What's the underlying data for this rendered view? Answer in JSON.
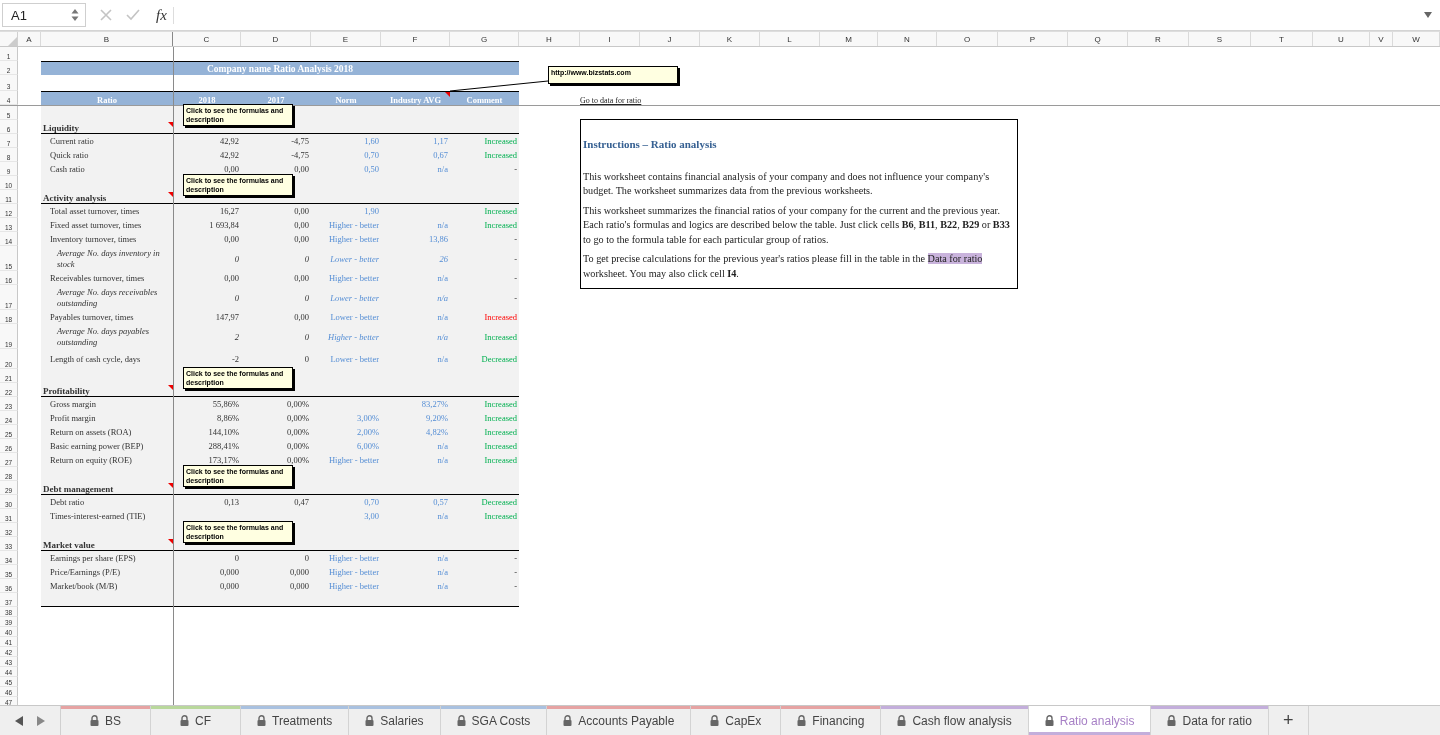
{
  "name_box": "A1",
  "function_label": "fx",
  "columns": [
    "A",
    "B",
    "C",
    "D",
    "E",
    "F",
    "G",
    "H",
    "I",
    "J",
    "K",
    "L",
    "M",
    "N",
    "O",
    "P",
    "Q",
    "R",
    "S",
    "T",
    "U",
    "V",
    "W"
  ],
  "rows": [
    {
      "n": "1",
      "kind": "blank"
    },
    {
      "n": "2",
      "kind": "title",
      "text": "Company name Ratio Analysis 2018"
    },
    {
      "n": "3",
      "kind": "blank"
    },
    {
      "n": "4",
      "kind": "header",
      "columns": [
        {
          "label": "Ratio"
        },
        {
          "label": "2018"
        },
        {
          "label": "2017"
        },
        {
          "label": "Norm"
        },
        {
          "label": "Industry AVG",
          "note": "http://www.bizstats.com"
        },
        {
          "label": "Comment"
        }
      ],
      "link": "Go to data for ratio"
    },
    {
      "n": "5",
      "kind": "gap"
    },
    {
      "n": "6",
      "kind": "section",
      "label": "Liquidity",
      "note": "Click to see the formulas and description"
    },
    {
      "n": "7",
      "kind": "item",
      "label": "Current ratio",
      "y2018": "42,92",
      "y2017": "-4,75",
      "norm": "1,60",
      "industry": "1,17",
      "comment": {
        "text": "Increased",
        "favorable": true
      }
    },
    {
      "n": "8",
      "kind": "item",
      "label": "Quick ratio",
      "y2018": "42,92",
      "y2017": "-4,75",
      "norm": "0,70",
      "industry": "0,67",
      "comment": {
        "text": "Increased",
        "favorable": true
      }
    },
    {
      "n": "9",
      "kind": "item",
      "label": "Cash ratio",
      "y2018": "0,00",
      "y2017": "0,00",
      "norm": "0,50",
      "industry": "n/a",
      "comment": {
        "text": "-"
      }
    },
    {
      "n": "10",
      "kind": "gap"
    },
    {
      "n": "11",
      "kind": "section",
      "label": "Activity analysis",
      "note": "Click to see the formulas and description"
    },
    {
      "n": "12",
      "kind": "item",
      "label": "Total asset turnover, times",
      "y2018": "16,27",
      "y2017": "0,00",
      "norm": "1,90",
      "comment": {
        "text": "Increased",
        "favorable": true
      }
    },
    {
      "n": "13",
      "kind": "item",
      "label": "Fixed asset turnover, times",
      "y2018": "1 693,84",
      "y2017": "0,00",
      "norm": "Higher - better",
      "industry": "n/a",
      "comment": {
        "text": "Increased",
        "favorable": true
      }
    },
    {
      "n": "14",
      "kind": "item",
      "label": "Inventory turnover, times",
      "y2018": "0,00",
      "y2017": "0,00",
      "norm": "Higher - better",
      "industry": "13,86",
      "comment": {
        "text": "-"
      }
    },
    {
      "n": "15",
      "kind": "sub",
      "label": "Average No. days inventory in stock",
      "y2018": "0",
      "y2017": "0",
      "norm": "Lower - better",
      "industry": "26",
      "comment": {
        "text": "-"
      }
    },
    {
      "n": "16",
      "kind": "item",
      "label": "Receivables turnover, times",
      "y2018": "0,00",
      "y2017": "0,00",
      "norm": "Higher - better",
      "industry": "n/a",
      "comment": {
        "text": "-"
      }
    },
    {
      "n": "17",
      "kind": "sub",
      "label": "Average No. days receivables outstanding",
      "y2018": "0",
      "y2017": "0",
      "norm": "Lower - better",
      "industry": "n/a",
      "comment": {
        "text": "-"
      }
    },
    {
      "n": "18",
      "kind": "item",
      "label": "Payables turnover, times",
      "y2018": "147,97",
      "y2017": "0,00",
      "norm": "Lower - better",
      "industry": "n/a",
      "comment": {
        "text": "Increased",
        "favorable": false
      }
    },
    {
      "n": "19",
      "kind": "sub",
      "label": "Average No. days payables outstanding",
      "y2018": "2",
      "y2017": "0",
      "norm": "Higher - better",
      "industry": "n/a",
      "comment": {
        "text": "Increased",
        "favorable": true
      }
    },
    {
      "n": "20",
      "kind": "item",
      "label": "Length of cash cycle, days",
      "y2018": "-2",
      "y2017": "0",
      "norm": "Lower - better",
      "industry": "n/a",
      "comment": {
        "text": "Decreased",
        "favorable": true
      }
    },
    {
      "n": "21",
      "kind": "gap"
    },
    {
      "n": "22",
      "kind": "section",
      "label": "Profitability",
      "note": "Click to see the formulas and description"
    },
    {
      "n": "23",
      "kind": "item",
      "label": "Gross margin",
      "y2018": "55,86%",
      "y2017": "0,00%",
      "industry": "83,27%",
      "comment": {
        "text": "Increased",
        "favorable": true
      }
    },
    {
      "n": "24",
      "kind": "item",
      "label": "Profit margin",
      "y2018": "8,86%",
      "y2017": "0,00%",
      "norm": "3,00%",
      "industry": "9,20%",
      "comment": {
        "text": "Increased",
        "favorable": true
      }
    },
    {
      "n": "25",
      "kind": "item",
      "label": "Return on assets (ROA)",
      "y2018": "144,10%",
      "y2017": "0,00%",
      "norm": "2,00%",
      "industry": "4,82%",
      "comment": {
        "text": "Increased",
        "favorable": true
      }
    },
    {
      "n": "26",
      "kind": "item",
      "label": "Basic earning power (BEP)",
      "y2018": "288,41%",
      "y2017": "0,00%",
      "norm": "6,00%",
      "industry": "n/a",
      "comment": {
        "text": "Increased",
        "favorable": true
      }
    },
    {
      "n": "27",
      "kind": "item",
      "label": "Return on equity (ROE)",
      "y2018": "173,17%",
      "y2017": "0,00%",
      "norm": "Higher - better",
      "industry": "n/a",
      "comment": {
        "text": "Increased",
        "favorable": true
      }
    },
    {
      "n": "28",
      "kind": "gap"
    },
    {
      "n": "29",
      "kind": "section",
      "label": "Debt management",
      "note": "Click to see the formulas and description"
    },
    {
      "n": "30",
      "kind": "item",
      "label": "Debt ratio",
      "y2018": "0,13",
      "y2017": "0,47",
      "norm": "0,70",
      "industry": "0,57",
      "comment": {
        "text": "Decreased",
        "favorable": true
      }
    },
    {
      "n": "31",
      "kind": "item",
      "label": "Times-interest-earned (TIE)",
      "norm": "3,00",
      "industry": "n/a",
      "comment": {
        "text": "Increased",
        "favorable": true
      }
    },
    {
      "n": "32",
      "kind": "gap"
    },
    {
      "n": "33",
      "kind": "section",
      "label": "Market value",
      "note": "Click to see the formulas and description"
    },
    {
      "n": "34",
      "kind": "item",
      "label": "Earnings per share (EPS)",
      "y2018": "0",
      "y2017": "0",
      "norm": "Higher - better",
      "industry": "n/a",
      "comment": {
        "text": "-"
      }
    },
    {
      "n": "35",
      "kind": "item",
      "label": "Price/Earnings (P/E)",
      "y2018": "0,000",
      "y2017": "0,000",
      "norm": "Higher - better",
      "industry": "n/a",
      "comment": {
        "text": "-"
      }
    },
    {
      "n": "36",
      "kind": "item",
      "label": "Market/book (M/B)",
      "y2018": "0,000",
      "y2017": "0,000",
      "norm": "Higher - better",
      "industry": "n/a",
      "comment": {
        "text": "-"
      }
    },
    {
      "n": "37",
      "kind": "end"
    },
    {
      "n": "38",
      "kind": "blank"
    },
    {
      "n": "39",
      "kind": "blank"
    },
    {
      "n": "40",
      "kind": "blank"
    },
    {
      "n": "41",
      "kind": "blank"
    },
    {
      "n": "42",
      "kind": "blank"
    },
    {
      "n": "43",
      "kind": "blank"
    },
    {
      "n": "44",
      "kind": "blank"
    },
    {
      "n": "45",
      "kind": "blank"
    },
    {
      "n": "46",
      "kind": "blank"
    },
    {
      "n": "47",
      "kind": "blank"
    }
  ],
  "instructions": {
    "title": "Instructions – Ratio analysis",
    "paragraphs": [
      {
        "text": "This worksheet contains financial analysis of your company and does not influence your company's budget. The worksheet summarizes data from the previous worksheets."
      },
      {
        "text": "This worksheet summarizes the financial ratios of your company for the current and the previous year. Each ratio's formulas and logics are described below the table. Just click cells **B6**, **B11**, **B22**, **B29** or **B33** to go to the formula table for each particular group of ratios."
      },
      {
        "text": "To get precise calculations for the previous year's ratios please fill in the table in the ",
        "highlight": "Data for ratio",
        "after": " worksheet. You may also click cell **I4**."
      }
    ]
  },
  "tabs": [
    {
      "label": "BS",
      "color": "#e6a3a3",
      "selected": false
    },
    {
      "label": "CF",
      "color": "#b9d89c",
      "selected": false
    },
    {
      "label": "Treatments",
      "color": "#a9c1e0",
      "selected": false
    },
    {
      "label": "Salaries",
      "color": "#a9c1e0",
      "selected": false
    },
    {
      "label": "SGA Costs",
      "color": "#a9c1e0",
      "selected": false
    },
    {
      "label": "Accounts Payable",
      "color": "#e6a3a3",
      "selected": false
    },
    {
      "label": "CapEx",
      "color": "#e6a3a3",
      "selected": false
    },
    {
      "label": "Financing",
      "color": "#e6a3a3",
      "selected": false
    },
    {
      "label": "Cash flow analysis",
      "color": "#c3aedb",
      "selected": false
    },
    {
      "label": "Ratio analysis",
      "color": "#c3aedb",
      "selected": true
    },
    {
      "label": "Data for ratio",
      "color": "#c3aedb",
      "selected": false
    }
  ],
  "add_sheet": "+"
}
